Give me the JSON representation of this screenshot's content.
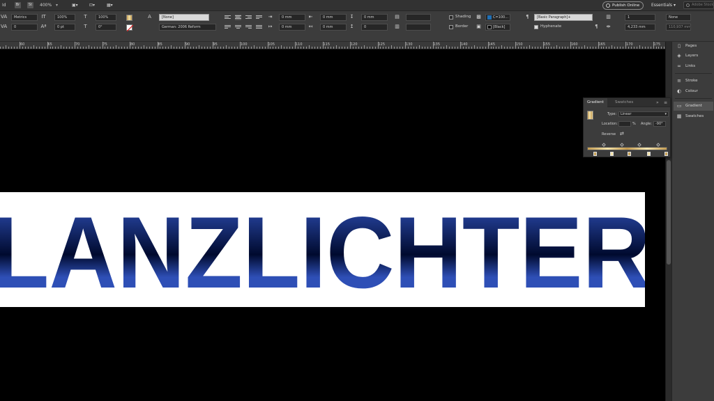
{
  "menubar": {
    "app_short": "Id",
    "br": "Br",
    "st": "St",
    "zoom": "400%",
    "publish": "Publish Online",
    "workspace": "Essentials",
    "search_placeholder": "Adobe Stock"
  },
  "character": {
    "kerning": "Metrics",
    "tracking": "0",
    "vscale": "100%",
    "hscale": "100%",
    "baseline": "0 pt",
    "skew": "0°",
    "char_style": "[None]",
    "language": "German: 2006 Reform"
  },
  "paragraph": {
    "indent_left": "0 mm",
    "indent_first": "0 mm",
    "indent_right": "0 mm",
    "indent_last": "0 mm",
    "space_before": "0 mm",
    "space_after": "0",
    "shading": "Shading",
    "border": "Border",
    "shading_colour": "C=100...",
    "border_colour": "[Black]",
    "para_style": "[Basic Paragraph]+",
    "hyphenate": "Hyphenate",
    "columns": "1",
    "gutter": "4,233 mm",
    "bullets": "None",
    "width": "110,937 mm"
  },
  "ruler": {
    "labels": [
      "60",
      "65",
      "70",
      "75",
      "80",
      "85",
      "90",
      "95",
      "100",
      "105",
      "110",
      "115",
      "120",
      "125",
      "130",
      "135",
      "140",
      "145",
      "150",
      "155",
      "160",
      "165",
      "170",
      "175"
    ]
  },
  "document": {
    "headline": "LANZLICHTER"
  },
  "dock": {
    "items": [
      "Pages",
      "Layers",
      "Links",
      "Stroke",
      "Colour",
      "Gradient",
      "Swatches"
    ]
  },
  "gradient_panel": {
    "tab_gradient": "Gradient",
    "tab_swatches": "Swatches",
    "type_label": "Type:",
    "type_value": "Linear",
    "location_label": "Location:",
    "location_value": "",
    "percent": "%",
    "angle_label": "Angle:",
    "angle_value": "-90°",
    "reverse_label": "Reverse"
  },
  "colors": {
    "headline_dark": "#000a2e",
    "headline_blue": "#2e4fb6",
    "gold_light": "#f3e2a8",
    "gold_dark": "#c59d52",
    "shading_swatch": "#1f6fb5"
  }
}
